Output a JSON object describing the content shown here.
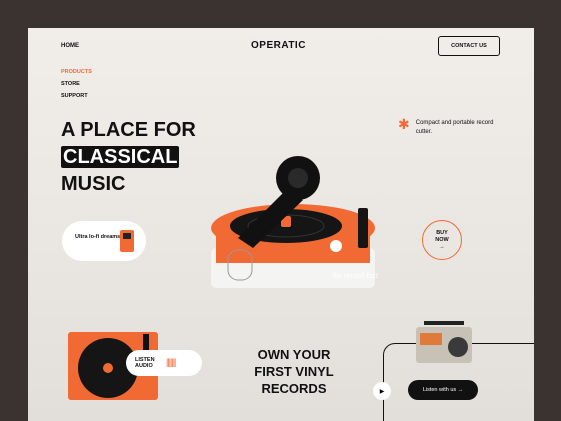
{
  "nav": {
    "home": "HOME",
    "logo": "OPERATIC",
    "contact": "CONTACT US"
  },
  "menu": [
    "PRODUCTS",
    "STORE",
    "SUPPORT"
  ],
  "hero": {
    "line1": "A PLACE FOR",
    "line2": "CLASSICAL",
    "line3": "MUSIC"
  },
  "feature": {
    "text": "Compact and portable record cutter."
  },
  "chips": {
    "ultra": "Ultra lo-fi dreams",
    "listen": "LISTEN AUDIO",
    "wave": "|||||||"
  },
  "buy": {
    "line1": "BUY",
    "line2": "NOW",
    "arrow": "→"
  },
  "brand_label": "the record factory",
  "section2": {
    "headline": "OWN YOUR FIRST VINYL RECORDS",
    "listen_btn": "Listen with us →",
    "play": "▶"
  },
  "colors": {
    "accent": "#f26a33",
    "frame": "#3b3330",
    "background": "#efebe7"
  }
}
